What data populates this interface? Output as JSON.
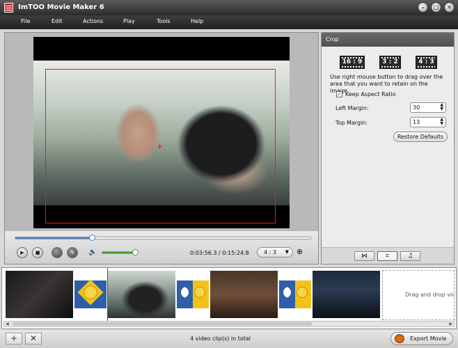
{
  "window": {
    "title": "ImTOO Movie Maker 6"
  },
  "menu": {
    "file": "File",
    "edit": "Edit",
    "actions": "Actions",
    "play": "Play",
    "tools": "Tools",
    "help": "Help"
  },
  "player": {
    "seek_fraction": 0.26,
    "volume_fraction": 1.0,
    "timecode": "0:03:56.3 / 0:15:24.8",
    "aspect_value": "4 : 3"
  },
  "crop": {
    "header": "Crop",
    "ratios": [
      "16:9",
      "3:2",
      "4:3"
    ],
    "hint": "Use right mouse button to drag over the area that you want to retain on the image.",
    "keep_aspect_label": "Keep Aspect Ratio",
    "keep_aspect_checked": true,
    "left_margin_label": "Left Margin:",
    "left_margin_value": "30",
    "top_margin_label": "Top Margin:",
    "top_margin_value": "13",
    "restore_label": "Restore Defaults"
  },
  "timeline": {
    "drop_text": "Drag and drop vide"
  },
  "status": {
    "clip_count": "4 video clip(s) in total",
    "export_label": "Export Movie"
  },
  "colors": {
    "accent_blue": "#4a7fd0",
    "volume_green": "#4a9c2e",
    "crop_red": "#e02020",
    "titlebar": "#3a3a3a"
  }
}
